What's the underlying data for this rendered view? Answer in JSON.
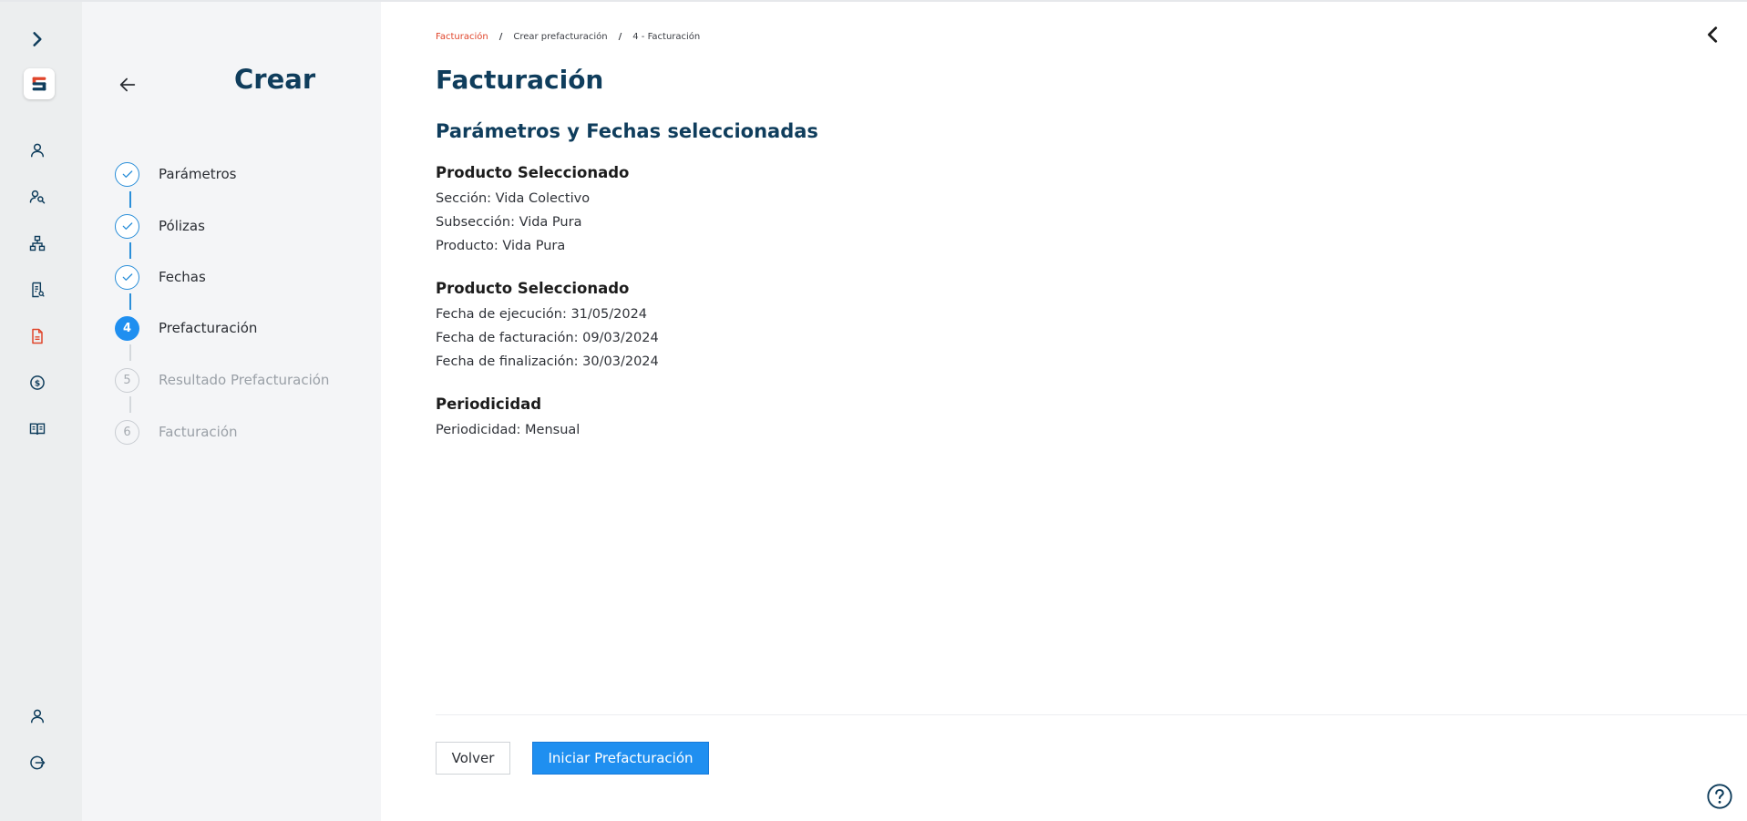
{
  "rail": {
    "icons": [
      "expand-chevron-icon",
      "app-logo",
      "user-icon",
      "users-search-icon",
      "hierarchy-icon",
      "policy-document-icon",
      "billing-document-icon",
      "dollar-coin-icon",
      "book-open-icon",
      "profile-icon",
      "logout-icon"
    ],
    "logo_letter": "S",
    "accent_color": "#e0452b",
    "primary_color": "#0f3d5c"
  },
  "steps_panel": {
    "title": "Crear",
    "steps": [
      {
        "number": "1",
        "label": "Parámetros",
        "status": "done"
      },
      {
        "number": "2",
        "label": "Pólizas",
        "status": "done"
      },
      {
        "number": "3",
        "label": "Fechas",
        "status": "done"
      },
      {
        "number": "4",
        "label": "Prefacturación",
        "status": "active"
      },
      {
        "number": "5",
        "label": "Resultado Prefacturación",
        "status": "pending"
      },
      {
        "number": "6",
        "label": "Facturación",
        "status": "pending"
      }
    ]
  },
  "breadcrumb": [
    "Facturación",
    "Crear prefacturación",
    "4 - Facturación"
  ],
  "main": {
    "title": "Facturación",
    "section_title": "Parámetros y Fechas seleccionadas",
    "groups": [
      {
        "heading": "Producto Seleccionado",
        "lines": [
          "Sección: Vida Colectivo",
          "Subsección: Vida Pura",
          "Producto: Vida Pura"
        ]
      },
      {
        "heading": "Producto Seleccionado",
        "lines": [
          "Fecha de ejecución: 31/05/2024",
          "Fecha de facturación: 09/03/2024",
          "Fecha de finalización: 30/03/2024"
        ]
      },
      {
        "heading": "Periodicidad",
        "lines": [
          "Periodicidad: Mensual"
        ]
      }
    ],
    "buttons": {
      "back": "Volver",
      "primary": "Iniciar Prefacturación"
    }
  },
  "colors": {
    "active_step": "#1f8ff0",
    "done_step": "#2b8fd9",
    "breadcrumb_active": "#e0452b"
  }
}
